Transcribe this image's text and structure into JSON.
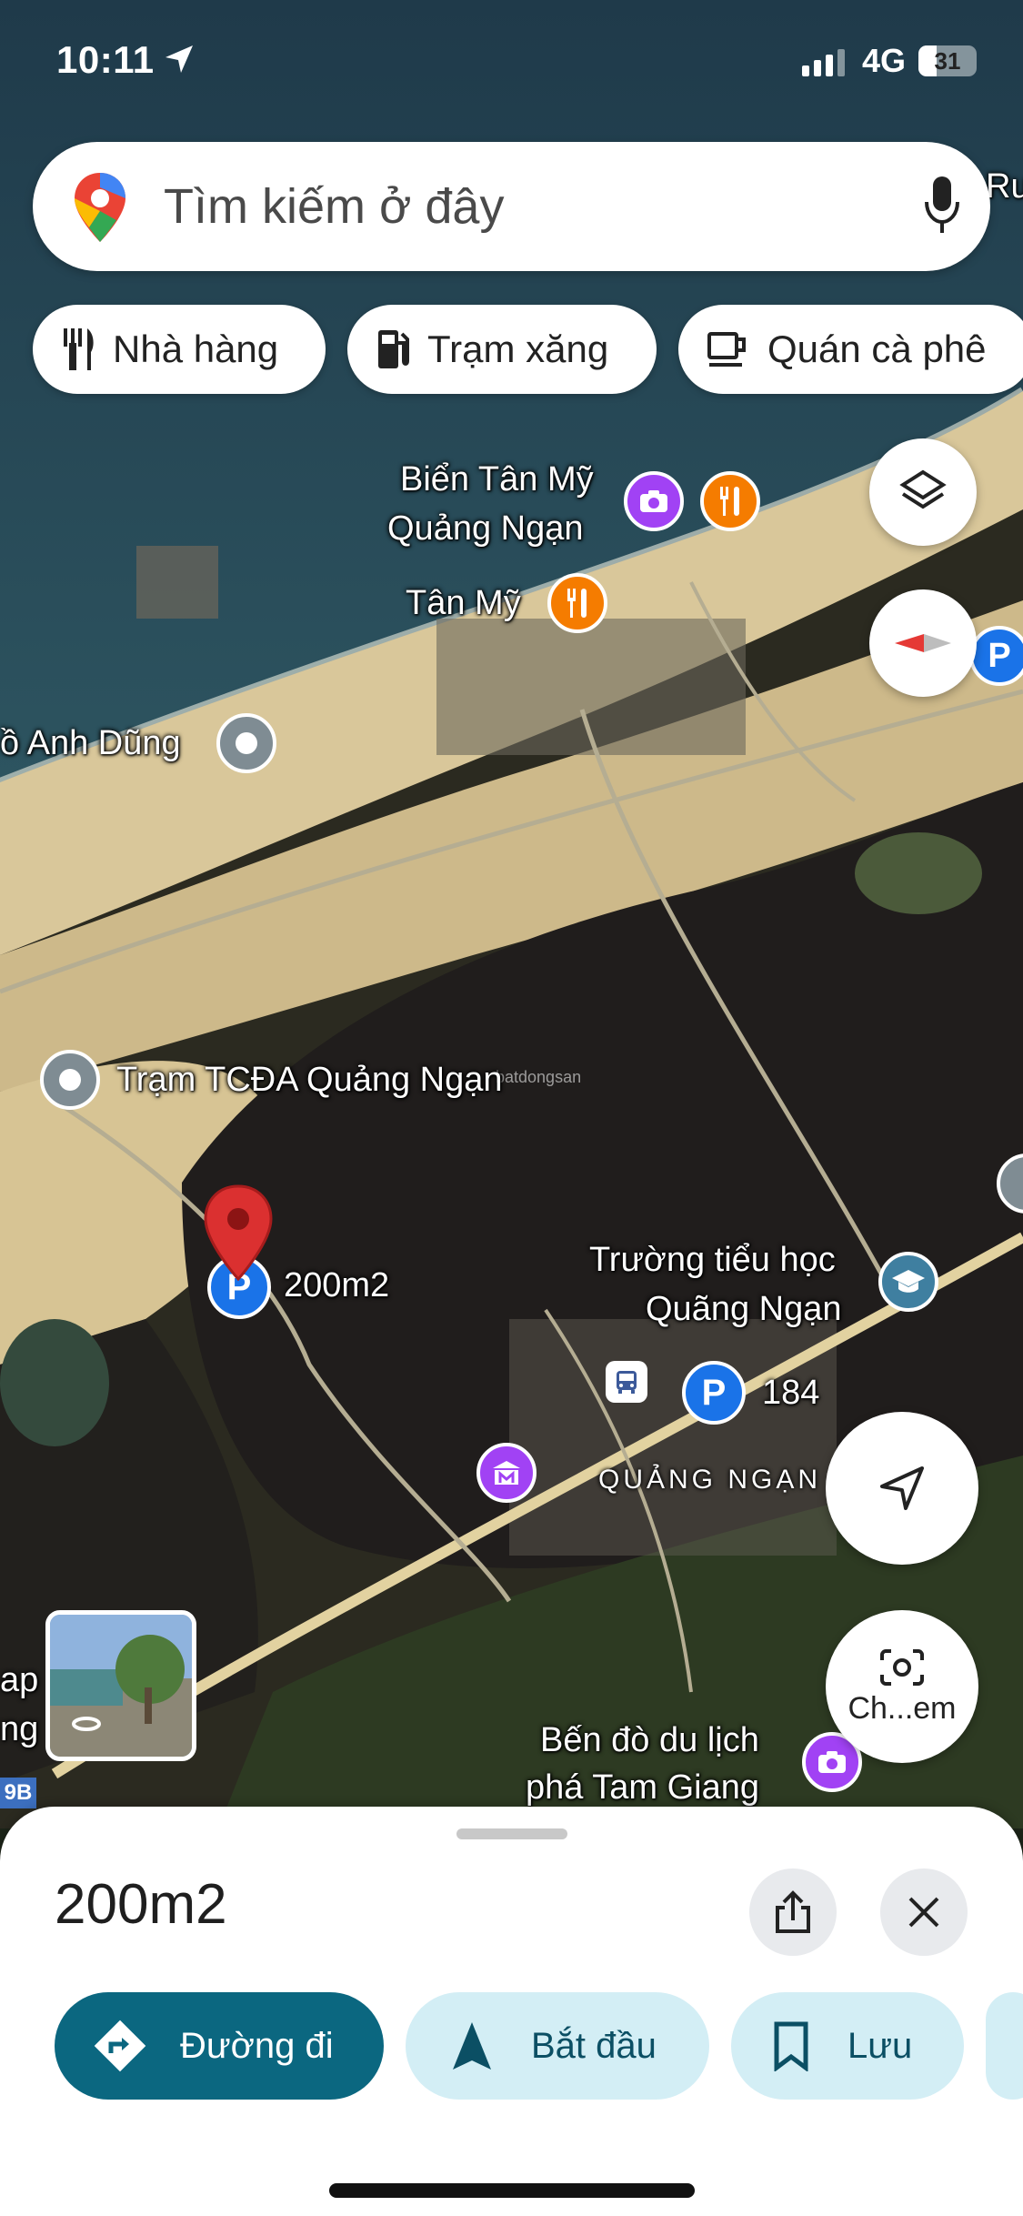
{
  "status_bar": {
    "time": "10:11",
    "network": "4G",
    "battery": "31",
    "battery_level": 0.31
  },
  "search": {
    "placeholder": "Tìm kiếm ở đây",
    "logo_icon": "google-maps-pin-icon",
    "mic_icon": "microphone-icon"
  },
  "chips": [
    {
      "label": "Nhà hàng",
      "icon": "fork-knife-icon"
    },
    {
      "label": "Trạm xăng",
      "icon": "gas-pump-icon"
    },
    {
      "label": "Quán cà phê",
      "icon": "coffee-cup-icon"
    }
  ],
  "map": {
    "labels": {
      "beach_line1": "Biển Tân Mỹ",
      "beach_line2": "Quảng Ngạn",
      "village": "Tân Mỹ",
      "hero": "ồ Anh Dũng",
      "station": "Trạm TCĐA Quảng Ngạn",
      "pin": "200m2",
      "school_line1": "Trường tiểu học",
      "school_line2": "Quãng Ngạn",
      "parking_number": "184",
      "area": "QUẢNG NGẠN",
      "ferry_line1": "Bến đò du lịch",
      "ferry_line2": "phá Tam Giang",
      "edge_left_1": "ap",
      "edge_left_2": "ng",
      "top_right_edge": "Ru",
      "road_shield": "9B",
      "watermark": "batdongsan"
    },
    "camera_button_label": "Ch...em",
    "icons": [
      "layers-icon",
      "compass-icon",
      "my-location-icon",
      "lens-camera-icon",
      "parking-icon",
      "restaurant-icon",
      "photo-spot-icon",
      "school-icon",
      "museum-icon",
      "bus-icon",
      "red-pin-icon",
      "street-view-thumbnail"
    ]
  },
  "sheet": {
    "title": "200m2",
    "share_icon": "share-icon",
    "close_icon": "close-icon",
    "actions": [
      {
        "label": "Đường đi",
        "icon": "directions-icon"
      },
      {
        "label": "Bắt đầu",
        "icon": "navigation-arrow-icon"
      },
      {
        "label": "Lưu",
        "icon": "bookmark-icon"
      }
    ]
  },
  "colors": {
    "primary": "#0b6780",
    "secondary_chip": "#d3eef5",
    "pin_red": "#db3030",
    "parking_blue": "#1a73e8",
    "photo_purple": "#a142f4",
    "food_orange": "#f57c00",
    "school_teal": "#3f7fa0",
    "museum_purple": "#a142f4"
  }
}
